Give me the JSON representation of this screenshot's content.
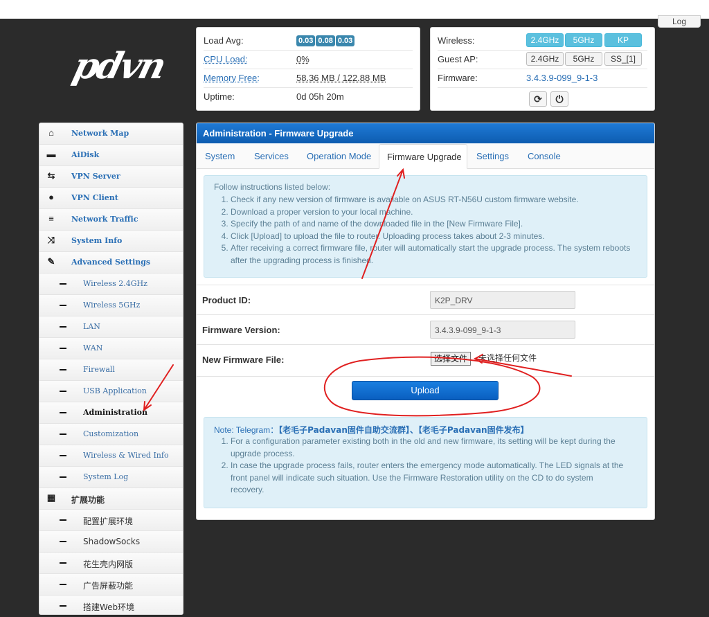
{
  "header": {
    "logout_label": "Log",
    "logo_text": "pdvn"
  },
  "status": {
    "load_avg_label": "Load Avg:",
    "load_avg": [
      "0.03",
      "0.08",
      "0.03"
    ],
    "cpu_label": "CPU Load:",
    "cpu_value": "0%",
    "memory_label": "Memory Free:",
    "memory_value": "58.36 MB / 122.88 MB",
    "uptime_label": "Uptime:",
    "uptime_value": "0d 05h 20m"
  },
  "wireless": {
    "wireless_label": "Wireless:",
    "wireless_buttons": [
      "2.4GHz",
      "5GHz",
      "KP"
    ],
    "guest_label": "Guest AP:",
    "guest_buttons": [
      "2.4GHz",
      "5GHz",
      "SS_[1]"
    ],
    "firmware_label": "Firmware:",
    "firmware_value": "3.4.3.9-099_9-1-3",
    "refresh_icon": "refresh-icon",
    "power_icon": "power-icon"
  },
  "sidebar": {
    "items": [
      {
        "label": "Network Map",
        "icon": "home-icon",
        "glyph": "⌂"
      },
      {
        "label": "AiDisk",
        "icon": "disk-icon",
        "glyph": "▬"
      },
      {
        "label": "VPN Server",
        "icon": "swap-icon",
        "glyph": "⇆"
      },
      {
        "label": "VPN Client",
        "icon": "globe-icon",
        "glyph": "●"
      },
      {
        "label": "Network Traffic",
        "icon": "list-icon",
        "glyph": "≡"
      },
      {
        "label": "System Info",
        "icon": "shuffle-icon",
        "glyph": "⤨"
      },
      {
        "label": "Advanced Settings",
        "icon": "wrench-icon",
        "glyph": "✎"
      }
    ],
    "sub_items": [
      "Wireless 2.4GHz",
      "Wireless 5GHz",
      "LAN",
      "WAN",
      "Firewall",
      "USB Application",
      "Administration",
      "Customization",
      "Wireless & Wired Info",
      "System Log"
    ],
    "ext_label": "扩展功能",
    "ext_icon": "grid-icon",
    "ext_items": [
      "配置扩展环境",
      "ShadowSocks",
      "花生壳内网版",
      "广告屏蔽功能",
      "搭建Web环境"
    ]
  },
  "main": {
    "title": "Administration - Firmware Upgrade",
    "tabs": [
      "System",
      "Services",
      "Operation Mode",
      "Firmware Upgrade",
      "Settings",
      "Console"
    ],
    "instructions_head": "Follow instructions listed below:",
    "instructions": [
      "Check if any new version of firmware is available on ASUS RT-N56U custom firmware website.",
      "Download a proper version to your local machine.",
      "Specify the path of and name of the downloaded file in the [New Firmware File].",
      "Click [Upload] to upload the file to router. Uploading process takes about 2-3 minutes.",
      "After receiving a correct firmware file, router will automatically start the upgrade process. The system reboots after the upgrading process is finished."
    ],
    "product_id_label": "Product ID:",
    "product_id_value": "K2P_DRV",
    "fw_version_label": "Firmware Version:",
    "fw_version_value": "3.4.3.9-099_9-1-3",
    "new_fw_label": "New Firmware File:",
    "file_button_label": "选择文件",
    "file_status": "未选择任何文件",
    "upload_label": "Upload",
    "note_prefix": "Note: Telegram：",
    "note_links": "【老毛子Padavan固件自助交流群】、【老毛子Padavan固件发布】",
    "notes": [
      "For a configuration parameter existing both in the old and new firmware, its setting will be kept during the upgrade process.",
      "In case the upgrade process fails, router enters the emergency mode automatically. The LED signals at the front panel will indicate such situation. Use the Firmware Restoration utility on the CD to do system recovery."
    ]
  },
  "colors": {
    "accent_blue": "#0d5cb0",
    "badge_blue": "#3a87ad",
    "wireless_on": "#5bc0de",
    "annotation_red": "#e02020"
  }
}
